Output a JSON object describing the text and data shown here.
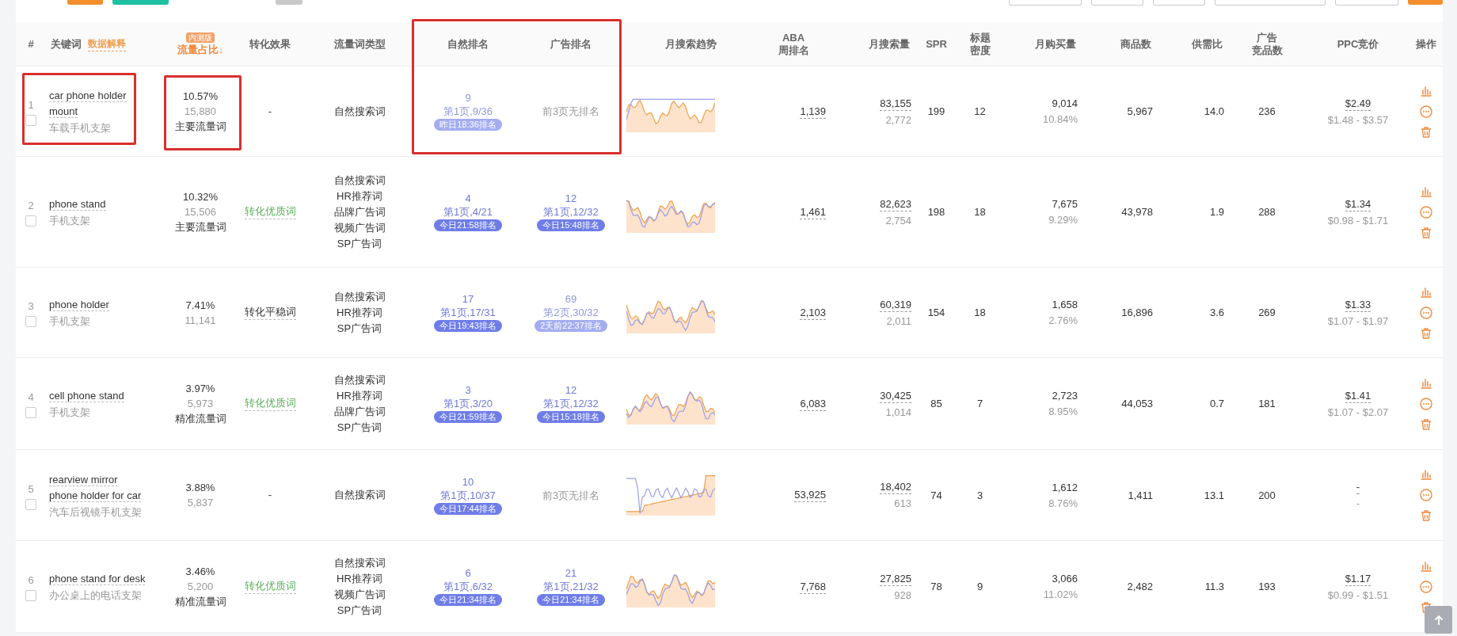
{
  "toolbar": {
    "buttons": [
      {
        "kind": "orange"
      },
      {
        "kind": "teal"
      },
      {
        "kind": "gray"
      },
      {
        "kind": "outline"
      },
      {
        "kind": "outline"
      },
      {
        "kind": "outline"
      },
      {
        "kind": "outline"
      },
      {
        "kind": "outline"
      },
      {
        "kind": "orange"
      }
    ]
  },
  "columns": [
    {
      "lines": [
        "#"
      ],
      "sorted": false
    },
    {
      "lines": [
        "关键词"
      ],
      "link": "数据解释",
      "sorted": false
    },
    {
      "lines": [
        "流量占比↓"
      ],
      "badge": "内测版",
      "sorted": true
    },
    {
      "lines": [
        "转化效果"
      ],
      "sorted": false
    },
    {
      "lines": [
        "流量词类型"
      ],
      "sorted": false
    },
    {
      "lines": [
        "自然排名"
      ],
      "sorted": false
    },
    {
      "lines": [
        "广告排名"
      ],
      "sorted": false
    },
    {
      "lines": [
        "月搜索趋势"
      ],
      "sorted": false
    },
    {
      "lines": [
        "ABA",
        "周排名"
      ],
      "sorted": false
    },
    {
      "lines": [
        "月搜索量"
      ],
      "sorted": false
    },
    {
      "lines": [
        "SPR"
      ],
      "sorted": false
    },
    {
      "lines": [
        "标题",
        "密度"
      ],
      "sorted": false
    },
    {
      "lines": [
        "月购买量"
      ],
      "sorted": false
    },
    {
      "lines": [
        "商品数"
      ],
      "sorted": false
    },
    {
      "lines": [
        "供需比"
      ],
      "sorted": false
    },
    {
      "lines": [
        "广告",
        "竞品数"
      ],
      "sorted": false
    },
    {
      "lines": [
        "PPC竞价"
      ],
      "sorted": false
    },
    {
      "lines": [
        "操作"
      ],
      "sorted": false
    }
  ],
  "rows": [
    {
      "index": "1",
      "keyword": "car phone holder mount",
      "translation": "车载手机支架",
      "checked": false,
      "share": {
        "percent": "10.57%",
        "clicks": "15,880",
        "label": "主要流量词"
      },
      "conversion": {
        "kind": "none",
        "text": "-"
      },
      "types": [
        "自然搜索词"
      ],
      "organic": {
        "kind": "ranked",
        "rank": "9",
        "page": "第1页,9/36",
        "badge": "昨日18:36排名",
        "fresh": false
      },
      "ad": {
        "kind": "none",
        "text": "前3页无排名"
      },
      "aba": "1,139",
      "search": {
        "volume": "83,155",
        "sub": "2,772"
      },
      "spr": "199",
      "density": "12",
      "purchases": {
        "count": "9,014",
        "rate": "10.84%"
      },
      "products": "5,967",
      "ratio": "14.0",
      "ad_products": "236",
      "ppc": {
        "bid": "$2.49",
        "range": "$1.48 - $3.57"
      }
    },
    {
      "index": "2",
      "keyword": "phone stand",
      "translation": "手机支架",
      "checked": false,
      "share": {
        "percent": "10.32%",
        "clicks": "15,506",
        "label": "主要流量词"
      },
      "conversion": {
        "kind": "good",
        "text": "转化优质词"
      },
      "types": [
        "自然搜索词",
        "HR推荐词",
        "品牌广告词",
        "视频广告词",
        "SP广告词"
      ],
      "organic": {
        "kind": "ranked",
        "rank": "4",
        "page": "第1页,4/21",
        "badge": "今日21:58排名",
        "fresh": true
      },
      "ad": {
        "kind": "ranked",
        "rank": "12",
        "page": "第1页,12/32",
        "badge": "今日15:48排名",
        "fresh": true
      },
      "aba": "1,461",
      "search": {
        "volume": "82,623",
        "sub": "2,754"
      },
      "spr": "198",
      "density": "18",
      "purchases": {
        "count": "7,675",
        "rate": "9.29%"
      },
      "products": "43,978",
      "ratio": "1.9",
      "ad_products": "288",
      "ppc": {
        "bid": "$1.34",
        "range": "$0.98 - $1.71"
      }
    },
    {
      "index": "3",
      "keyword": "phone holder",
      "translation": "手机支架",
      "checked": false,
      "share": {
        "percent": "7.41%",
        "clicks": "11,141"
      },
      "conversion": {
        "kind": "stable",
        "text": "转化平稳词"
      },
      "types": [
        "自然搜索词",
        "HR推荐词",
        "SP广告词"
      ],
      "organic": {
        "kind": "ranked",
        "rank": "17",
        "page": "第1页,17/31",
        "badge": "今日19:43排名",
        "fresh": true
      },
      "ad": {
        "kind": "ranked",
        "rank": "69",
        "page": "第2页,30/32",
        "badge": "2天前22:37排名",
        "fresh": false
      },
      "aba": "2,103",
      "search": {
        "volume": "60,319",
        "sub": "2,011"
      },
      "spr": "154",
      "density": "18",
      "purchases": {
        "count": "1,658",
        "rate": "2.76%"
      },
      "products": "16,896",
      "ratio": "3.6",
      "ad_products": "269",
      "ppc": {
        "bid": "$1.33",
        "range": "$1.07 - $1.97"
      }
    },
    {
      "index": "4",
      "keyword": "cell phone stand",
      "translation": "手机支架",
      "checked": false,
      "share": {
        "percent": "3.97%",
        "clicks": "5,973",
        "label": "精准流量词"
      },
      "conversion": {
        "kind": "good",
        "text": "转化优质词"
      },
      "types": [
        "自然搜索词",
        "HR推荐词",
        "品牌广告词",
        "SP广告词"
      ],
      "organic": {
        "kind": "ranked",
        "rank": "3",
        "page": "第1页,3/20",
        "badge": "今日21:59排名",
        "fresh": true
      },
      "ad": {
        "kind": "ranked",
        "rank": "12",
        "page": "第1页,12/32",
        "badge": "今日15:18排名",
        "fresh": true
      },
      "aba": "6,083",
      "search": {
        "volume": "30,425",
        "sub": "1,014"
      },
      "spr": "85",
      "density": "7",
      "purchases": {
        "count": "2,723",
        "rate": "8.95%"
      },
      "products": "44,053",
      "ratio": "0.7",
      "ad_products": "181",
      "ppc": {
        "bid": "$1.41",
        "range": "$1.07 - $2.07"
      }
    },
    {
      "index": "5",
      "keyword": "rearview mirror phone holder for car",
      "translation": "汽车后视镜手机支架",
      "checked": false,
      "share": {
        "percent": "3.88%",
        "clicks": "5,837"
      },
      "conversion": {
        "kind": "none",
        "text": "-"
      },
      "types": [
        "自然搜索词"
      ],
      "organic": {
        "kind": "ranked",
        "rank": "10",
        "page": "第1页,10/37",
        "badge": "今日17:44排名",
        "fresh": true
      },
      "ad": {
        "kind": "none",
        "text": "前3页无排名"
      },
      "aba": "53,925",
      "search": {
        "volume": "18,402",
        "sub": "613"
      },
      "spr": "74",
      "density": "3",
      "purchases": {
        "count": "1,612",
        "rate": "8.76%"
      },
      "products": "1,411",
      "ratio": "13.1",
      "ad_products": "200",
      "ppc": {
        "bid": "-",
        "range": "-"
      }
    },
    {
      "index": "6",
      "keyword": "phone stand for desk",
      "translation": "办公桌上的电话支架",
      "checked": false,
      "share": {
        "percent": "3.46%",
        "clicks": "5,200",
        "label": "精准流量词"
      },
      "conversion": {
        "kind": "good",
        "text": "转化优质词"
      },
      "types": [
        "自然搜索词",
        "HR推荐词",
        "视频广告词",
        "SP广告词"
      ],
      "organic": {
        "kind": "ranked",
        "rank": "6",
        "page": "第1页,6/32",
        "badge": "今日21:34排名",
        "fresh": true
      },
      "ad": {
        "kind": "ranked",
        "rank": "21",
        "page": "第1页,21/32",
        "badge": "今日21:34排名",
        "fresh": true
      },
      "aba": "7,768",
      "search": {
        "volume": "27,825",
        "sub": "928"
      },
      "spr": "78",
      "density": "9",
      "purchases": {
        "count": "3,066",
        "rate": "11.02%"
      },
      "products": "2,482",
      "ratio": "11.3",
      "ad_products": "193",
      "ppc": {
        "bid": "$1.17",
        "range": "$0.99 - $1.51"
      }
    }
  ],
  "highlights": {
    "keyword_cell": true,
    "share_cell": true,
    "rank_columns": true
  }
}
